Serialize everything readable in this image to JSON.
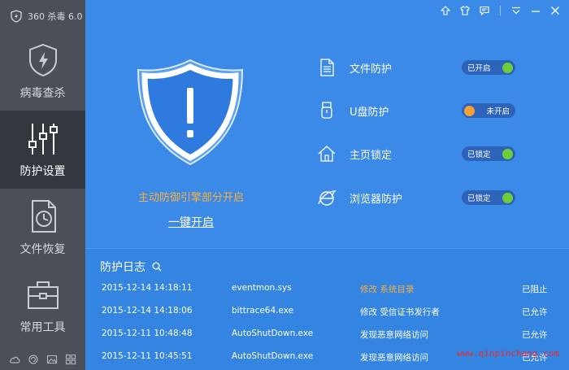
{
  "app": {
    "title": "360 杀毒 6.0"
  },
  "colors": {
    "main_bg": "#3b8ae8",
    "sidebar_bg": "#4a4f58",
    "active_bg": "#33373e",
    "on": "#6fcd3a",
    "off": "#f7a035",
    "warning_text": "#f7b040"
  },
  "sidebar": {
    "items": [
      {
        "label": "病毒查杀",
        "icon": "shield-bolt-icon",
        "active": false
      },
      {
        "label": "防护设置",
        "icon": "sliders-icon",
        "active": true
      },
      {
        "label": "文件恢复",
        "icon": "file-clock-icon",
        "active": false
      },
      {
        "label": "常用工具",
        "icon": "toolbox-icon",
        "active": false
      }
    ],
    "bottom_icons": [
      "cloud-icon",
      "refresh-icon",
      "image-icon",
      "grid-icon"
    ]
  },
  "window_controls": [
    "upload-icon",
    "shirt-icon",
    "chat-icon",
    "menu-icon",
    "minimize-icon",
    "close-icon"
  ],
  "status": {
    "message": "主动防御引擎部分开启",
    "action": "一键开启"
  },
  "protections": [
    {
      "label": "文件防护",
      "icon": "file-icon",
      "state": "已开启",
      "on": true
    },
    {
      "label": "U盘防护",
      "icon": "usb-icon",
      "state": "未开启",
      "on": false
    },
    {
      "label": "主页锁定",
      "icon": "home-icon",
      "state": "已锁定",
      "on": true
    },
    {
      "label": "浏览器防护",
      "icon": "ie-icon",
      "state": "已锁定",
      "on": true
    }
  ],
  "log": {
    "title": "防护日志",
    "rows": [
      {
        "time": "2015-12-14 14:18:11",
        "process": "eventmon.sys",
        "action": "修改 系统目录",
        "result": "已阻止",
        "highlight": true
      },
      {
        "time": "2015-12-14 14:18:06",
        "process": "bittrace64.exe",
        "action": "修改 受信证书发行者",
        "result": "已允许",
        "highlight": false
      },
      {
        "time": "2015-12-11 10:48:48",
        "process": "AutoShutDown.exe",
        "action": "发现恶意网络访问",
        "result": "已允许",
        "highlight": false
      },
      {
        "time": "2015-12-11 10:45:51",
        "process": "AutoShutDown.exe",
        "action": "发现恶意网络访问",
        "result": "已允许",
        "highlight": false
      }
    ]
  },
  "watermark": "www.qinpinchang.com"
}
